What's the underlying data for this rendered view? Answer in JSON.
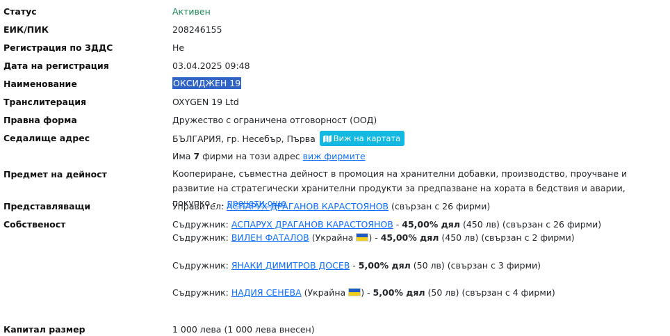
{
  "fields": {
    "status": {
      "label": "Статус",
      "value": "Активен"
    },
    "eik": {
      "label": "ЕИК/ПИК",
      "value": "208246155"
    },
    "vat": {
      "label": "Регистрация по ЗДДС",
      "value": "Не"
    },
    "reg_date": {
      "label": "Дата на регистрация",
      "value": "03.04.2025 09:48"
    },
    "name": {
      "label": "Наименование",
      "value": "ОКСИДЖЕН 19"
    },
    "translit": {
      "label": "Транслитерация",
      "value": "OXYGEN 19 Ltd"
    },
    "legal_form": {
      "label": "Правна форма",
      "value": "Дружество с ограничена отговорност (ООД)"
    },
    "address": {
      "label": "Седалище адрес",
      "value": "БЪЛГАРИЯ, гр. Несебър, Първа",
      "map_button": "Виж на картата",
      "firms_prefix": "Има",
      "firms_count": "7",
      "firms_suffix": "фирми на този адрес",
      "firms_link": "виж фирмите"
    },
    "activity": {
      "label": "Предмет на дейност",
      "value": "Коопериране, съвместна дейност в промоция на хранителни добавки, производство, проучване и развитие на стратегически хранителни продукти за предпазване на хората в бедствия и аварии, покупко -...",
      "more_link": "прочети още"
    },
    "representatives": {
      "label": "Представляващи",
      "role": "Управител:",
      "name": "АСПАРУХ ДРАГАНОВ КАРАСТОЯНОВ",
      "note": "(свързан с 26 фирми)"
    },
    "ownership": {
      "label": "Собственост",
      "partners": [
        {
          "role": "Съдружник:",
          "name": "АСПАРУХ ДРАГАНОВ КАРАСТОЯНОВ",
          "country": "",
          "share": "45,00% дял",
          "amount": "(450 лв)",
          "note": "(свързан с 26 фирми)"
        },
        {
          "role": "Съдружник:",
          "name": "ВИЛЕН ФАТАЛОВ",
          "country": "(Украйна",
          "share": "45,00% дял",
          "amount": "(450 лв)",
          "note": "(свързан с 2 фирми)"
        },
        {
          "role": "Съдружник:",
          "name": "ЯНАКИ ДИМИТРОВ ДОСЕВ",
          "country": "",
          "share": "5,00% дял",
          "amount": "(50 лв)",
          "note": "(свързан с 3 фирми)"
        },
        {
          "role": "Съдружник:",
          "name": "НАДИЯ СЕНЕВА",
          "country": "(Украйна",
          "share": "5,00% дял",
          "amount": "(50 лв)",
          "note": "(свързан с 4 фирми)"
        }
      ]
    },
    "capital": {
      "label": "Капитал размер",
      "value": "1 000 лева (1 000 лева внесен)"
    }
  },
  "colors": {
    "status_active": "#198754",
    "link": "#0d6efd",
    "map_button": "#13b9e0",
    "selection": "#2f63c8"
  },
  "icons": {
    "map_button_icon": "map-icon",
    "flag": "ukraine-flag-icon"
  }
}
